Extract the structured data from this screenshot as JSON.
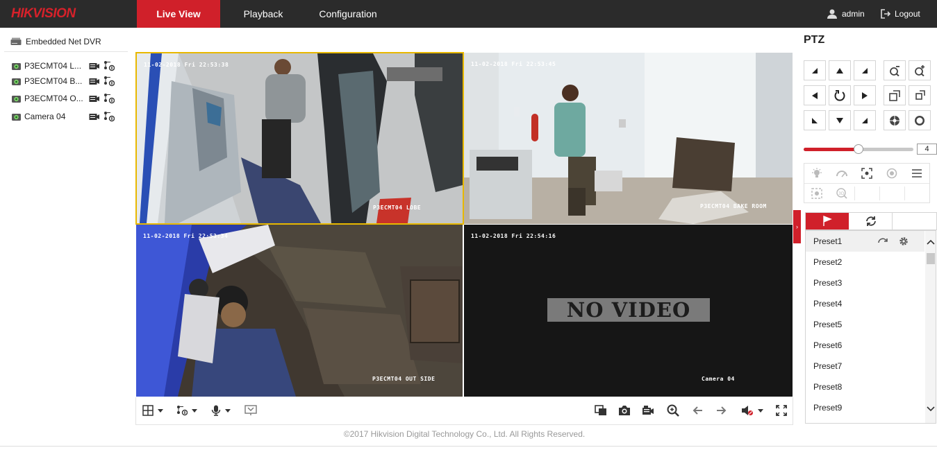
{
  "header": {
    "logo": "HIKVISION",
    "tabs": [
      {
        "label": "Live View",
        "active": true
      },
      {
        "label": "Playback",
        "active": false
      },
      {
        "label": "Configuration",
        "active": false
      }
    ],
    "user": {
      "name": "admin",
      "icon": "user-icon"
    },
    "logout": {
      "label": "Logout",
      "icon": "logout-icon"
    }
  },
  "device_tree": {
    "root": {
      "label": "Embedded Net DVR",
      "icon": "dvr-icon"
    },
    "cameras": [
      {
        "label": "P3ECMT04 LOBE",
        "display": "P3ECMT04 L..."
      },
      {
        "label": "P3ECMT04 BAKE ROOM",
        "display": "P3ECMT04 B..."
      },
      {
        "label": "P3ECMT04 OUT SIDE",
        "display": "P3ECMT04 O..."
      },
      {
        "label": "Camera 04",
        "display": "Camera 04"
      }
    ]
  },
  "video_tiles": [
    {
      "timestamp": "11-02-2018 Fri 22:53:38",
      "channel": "P3ECMT04 LOBE",
      "selected": true
    },
    {
      "timestamp": "11-02-2018 Fri 22:53:45",
      "channel": "P3ECMT04 BAKE ROOM",
      "selected": false
    },
    {
      "timestamp": "11-02-2018 Fri 22:53:34",
      "channel": "P3ECMT04 OUT SIDE",
      "selected": false
    },
    {
      "timestamp": "11-02-2018 Fri 22:54:16",
      "channel": "Camera 04",
      "selected": false,
      "message": "NO VIDEO"
    }
  ],
  "footer": "©2017 Hikvision Digital Technology Co., Ltd. All Rights Reserved.",
  "ptz": {
    "title": "PTZ",
    "speed": "4",
    "speed_level": 0.5,
    "presets": [
      "Preset1",
      "Preset2",
      "Preset3",
      "Preset4",
      "Preset5",
      "Preset6",
      "Preset7",
      "Preset8",
      "Preset9"
    ]
  },
  "colors": {
    "brand_red": "#d0202a",
    "topbar": "#2b2b2b",
    "selected_tile_border": "#e8b800"
  }
}
